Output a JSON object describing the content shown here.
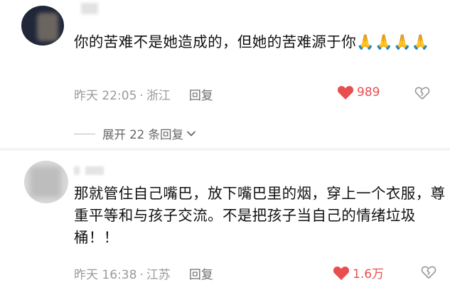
{
  "comments": [
    {
      "text": "你的苦难不是她造成的，但她的苦难源于你🙏🙏🙏🙏",
      "time": "昨天 22:05",
      "location": "浙江",
      "reply_label": "回复",
      "likes": "989"
    },
    {
      "text": "那就管住自己嘴巴，放下嘴巴里的烟，穿上一个衣服，尊重平等和与孩子交流。不是把孩子当自己的情绪垃圾桶！！",
      "time": "昨天 16:38",
      "location": "江苏",
      "reply_label": "回复",
      "likes": "1.6万"
    }
  ],
  "expand_replies": "展开 22 条回复",
  "colors": {
    "like": "#e94e4e",
    "meta": "#9a9a9a",
    "text": "#111111"
  },
  "icons": [
    "heart-icon",
    "broken-heart-icon",
    "chevron-down-icon",
    "pray-emoji"
  ]
}
